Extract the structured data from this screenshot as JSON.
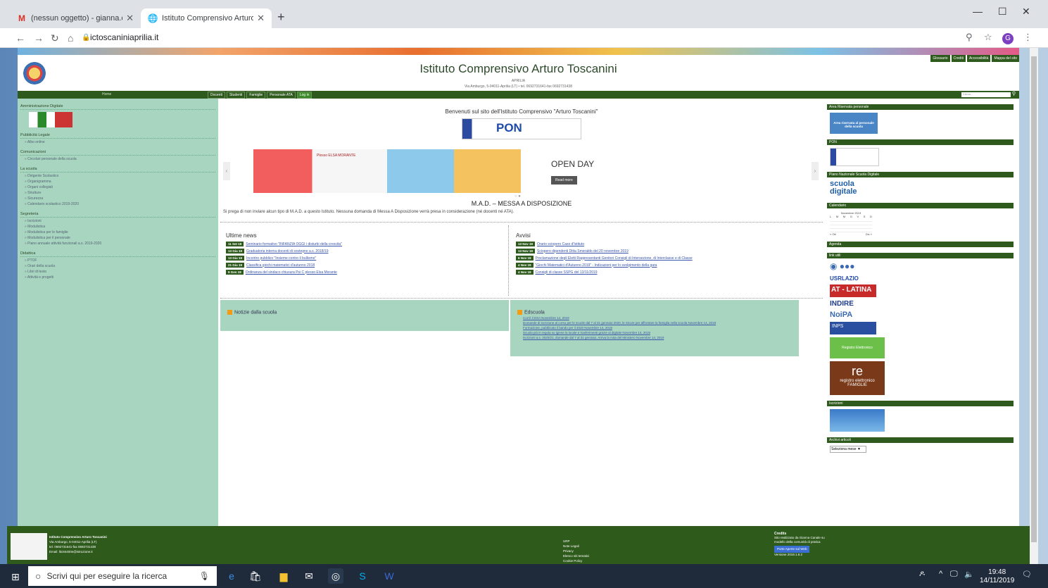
{
  "browser": {
    "tabs": [
      {
        "label": "(nessun oggetto) - gianna.canale",
        "icon": "gmail-icon"
      },
      {
        "label": "Istituto Comprensivo Arturo Tosca",
        "icon": "globe-icon"
      }
    ],
    "url": "ictoscaniniaprilia.it",
    "avatar_letter": "G"
  },
  "site": {
    "toplinks": [
      "Glossario",
      "Crediti",
      "Accessibilità",
      "Mappa del sito"
    ],
    "title": "Istituto Comprensivo Arturo Toscanini",
    "city": "APRILIA",
    "address_line": "Via Amburgo, 5-04011-Aprilia (LT) • tel. 0692731641-fax 0692731438",
    "menu_home": "Home",
    "menu": [
      "Docenti",
      "Studenti",
      "Famiglie",
      "Personale ATA",
      "Log in"
    ],
    "search_placeholder": "Cerca..."
  },
  "sidebar_left": [
    {
      "title": "Amministrazione Digitale",
      "items": []
    },
    {
      "title": "Pubblicità Legale",
      "items": [
        "Albo online"
      ]
    },
    {
      "title": "Comunicazioni",
      "items": [
        "Circolari personale della scuola"
      ]
    },
    {
      "title": "La scuola",
      "items": [
        "Dirigente Scolastico",
        "Organigramma",
        "Organi collegiali",
        "Strutture",
        "Sicurezza",
        "Calendario scolastico 2019-2020"
      ]
    },
    {
      "title": "Segreteria",
      "items": [
        "Iscrizioni",
        "Modulistica",
        "Modulistica per le famiglie",
        "Modulistica per il personale",
        "Piano annuale attività funzionali a.s. 2019-2020"
      ]
    },
    {
      "title": "Didattica",
      "items": [
        "PTOF",
        "Orari della scuola",
        "Libri di testo",
        "Attività e progetti"
      ]
    }
  ],
  "main": {
    "welcome": "Benvenuti sul sito dell'Istituto Comprensivo \"Arturo Toscanini\"",
    "pon_text": "PON",
    "slider_caption": "Plesso ELSA MORANTE",
    "openday": "OPEN DAY",
    "readmore": "Read more",
    "mad_title": "M.A.D. – MESSA A DISPOSIZIONE",
    "mad_text": "Si prega di non inviare alcun tipo di M.A.D. a questo Istituto. Nessuna domanda di Messa A Disposizione verrà presa in considerazione (né docenti né ATA).",
    "news_title": "Ultime news",
    "news": [
      {
        "date": "11 Set 19",
        "text": "Seminario formativo \"INFANZIA OGGI i disturbi della crescita\""
      },
      {
        "date": "13 Giu 19",
        "text": "Graduatoria interna docenti di sostegno a.s. 2018/19"
      },
      {
        "date": "13 Giu 19",
        "text": "Incontro pubblico \"Insieme contro il bullismo\""
      },
      {
        "date": "21 Giu 19",
        "text": "Classifica giochi matematici d'autunno 2018"
      },
      {
        "date": "9 Gen 19",
        "text": "Ordinanza del sindaco chiusura Psi C plesso Elsa Morante"
      }
    ],
    "avvisi_title": "Avvisi",
    "avvisi": [
      {
        "date": "13 Nov 19",
        "text": "Orario sciopero Caso d'Istituto"
      },
      {
        "date": "13 Nov 19",
        "text": "Sciopero dipendenti Ditta Smeraldo del 20 novembre 2019"
      },
      {
        "date": "6 Nov 19",
        "text": "Proclamazione degli Eletti Rappresentanti Genitori Consigli di Intersezione, di Interclasse e di Classe"
      },
      {
        "date": "4 Nov 19",
        "text": "\"Giochi Matematici d'Autunno 2019\" - Indicazioni per lo svolgimento della gara"
      },
      {
        "date": "4 Nov 19",
        "text": "Consigli di classe SSPG del 13/11/2019"
      }
    ],
    "notizie_title": "Notizie dalla scuola",
    "edscuola_title": "Edscuola",
    "edscuola": [
      "Cos'è il DSA Novembre 14, 2019",
      "Domande di iscrizione al corso per le scuole dal 7 al 31 gennaio 2020, le Sicure per affrontare la famiglia nella scuola Novembre 14, 2019",
      "Formazione, pubblicato il bando per il 2020 Novembre 14, 2019",
      "Scuola più in regola su igiene la locale e trasferimenti grazie al digitale Novembre 14, 2019",
      "Iscrizioni a.s. 2020/21, domande dal 7 al 31 gennaio. Arriva la nota del Ministero Novembre 14, 2019"
    ]
  },
  "sidebar_right": {
    "widgets": [
      "Area Riservata personale",
      "PON",
      "Piano Nazionale Scuola Digitale",
      "Calendario",
      "Agenda",
      "link utili",
      "Iscrizioni",
      "Archivi articoli"
    ],
    "area_riservata_text": "Area riservata al personale della scuola",
    "calendar_month": "Novembre 2019",
    "calendar_days": [
      "L",
      "M",
      "M",
      "G",
      "V",
      "S",
      "D"
    ],
    "calendar_prev": "« Ott",
    "calendar_next": "Dic »",
    "scuola_digitale": "scuola digitale",
    "usr": "USRLAZIO",
    "at_latina": "AT - LATINA",
    "indire": "INDIRE",
    "noipa": "NoiPA",
    "inps": "INPS",
    "registro1": "Registro Elettronico",
    "registro2_title": "registro elettronico",
    "registro2_sub": "FAMIGLIE",
    "archive_select": "Seleziona mese"
  },
  "footer": {
    "school_name": "Istituto Comprensivo Arturo Toscanini",
    "addr1": "Via Amburgo, 5-04011-Aprilia (LT)",
    "addr2": "tel. 0692731641-fax 0692731438",
    "email": "Email: ltic84400e@istruzione.it",
    "links": [
      "URP",
      "Note Legali",
      "Privacy",
      "Elenco siti tematici",
      "Cookie Policy"
    ],
    "credits_title": "Credits",
    "credits_text": "Sito realizzato da Gianna Canale su modello della comunità di pratica",
    "credits_button": "Porte Aperte sul Web",
    "version": "Versione 2019.1.8.2"
  },
  "taskbar": {
    "search_placeholder": "Scrivi qui per eseguire la ricerca",
    "time": "19:48",
    "date": "14/11/2019"
  }
}
